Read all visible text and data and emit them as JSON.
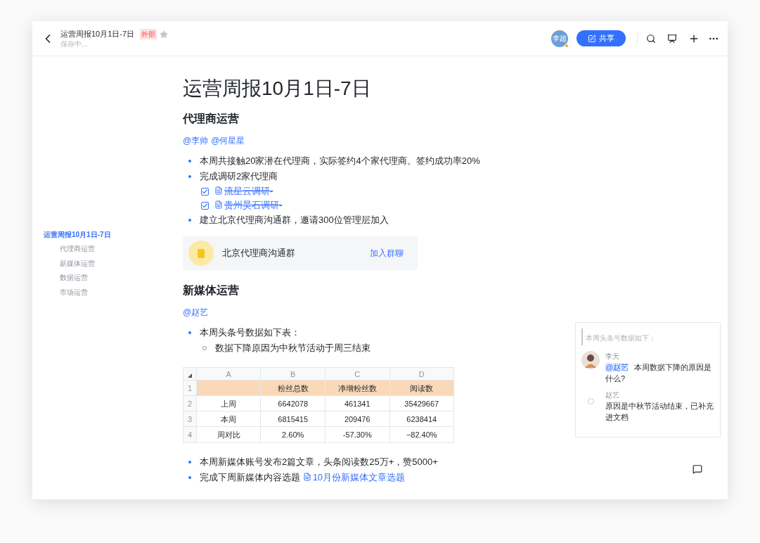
{
  "header": {
    "title": "运营周报10月1日-7日",
    "tag": "外部",
    "starred": false,
    "status": "保存中...",
    "avatar": "李超",
    "share": "共享"
  },
  "outline": [
    {
      "label": "运营周报10月1日-7日",
      "selected": true,
      "children": [
        {
          "label": "代理商运营",
          "selected": false
        },
        {
          "label": "新媒体运营",
          "selected": false
        },
        {
          "label": "数据运营",
          "selected": false
        },
        {
          "label": "市场运营",
          "selected": false
        }
      ]
    }
  ],
  "doc": {
    "title": "运营周报10月1日-7日",
    "sections": [
      {
        "heading": "代理商运营",
        "mentions": [
          "@李帅",
          "@何星星"
        ],
        "blocks": [
          {
            "kind": "bullet",
            "text": "本周共接触20家潜在代理商，实际签约4个家代理商。签约成功率20%"
          },
          {
            "kind": "bullet",
            "text": "完成调研2家代理商"
          },
          {
            "kind": "task",
            "checked": true,
            "link": "流星云调研-"
          },
          {
            "kind": "task",
            "checked": true,
            "link": "贵州昊石调研-"
          },
          {
            "kind": "bullet",
            "text": "建立北京代理商沟通群，邀请300位管理层加入"
          },
          {
            "kind": "group",
            "name": "北京代理商沟通群",
            "action": "加入群聊"
          }
        ]
      },
      {
        "heading": "新媒体运营",
        "mentions": [
          "@赵艺"
        ],
        "blocks": [
          {
            "kind": "bullet",
            "text": "本周头条号数据如下表："
          },
          {
            "kind": "subbullet",
            "text": "数据下降原因为中秋节活动于周三结束"
          },
          {
            "kind": "table",
            "columns": [
              "A",
              "B",
              "C",
              "D"
            ],
            "rows": [
              {
                "num": "1",
                "header": true,
                "cells": [
                  "",
                  "粉丝总数",
                  "净增粉丝数",
                  "阅读数"
                ]
              },
              {
                "num": "2",
                "header": false,
                "cells": [
                  "上周",
                  "6642078",
                  "461341",
                  "35429667"
                ]
              },
              {
                "num": "3",
                "header": false,
                "cells": [
                  "本周",
                  "6815415",
                  "209476",
                  "6238414"
                ]
              },
              {
                "num": "4",
                "header": false,
                "cells": [
                  "周对比",
                  "2.60%",
                  "-57.30%",
                  "−82.40%"
                ]
              }
            ]
          },
          {
            "kind": "bullet",
            "text": "本周新媒体账号发布2篇文章，头条阅读数25万+，赞5000+"
          },
          {
            "kind": "bullet",
            "text": "完成下周新媒体内容选题 ",
            "link": "10月份新媒体文章选题"
          }
        ]
      }
    ]
  },
  "comments": {
    "quote": "本周头条号数据如下：",
    "items": [
      {
        "author": "李天",
        "mention": "@赵艺",
        "text": "本周数据下降的原因是什么?"
      },
      {
        "kind": "plain",
        "author": "赵艺",
        "text": "原因是中秋节活动结束，已补充进文档"
      }
    ]
  }
}
